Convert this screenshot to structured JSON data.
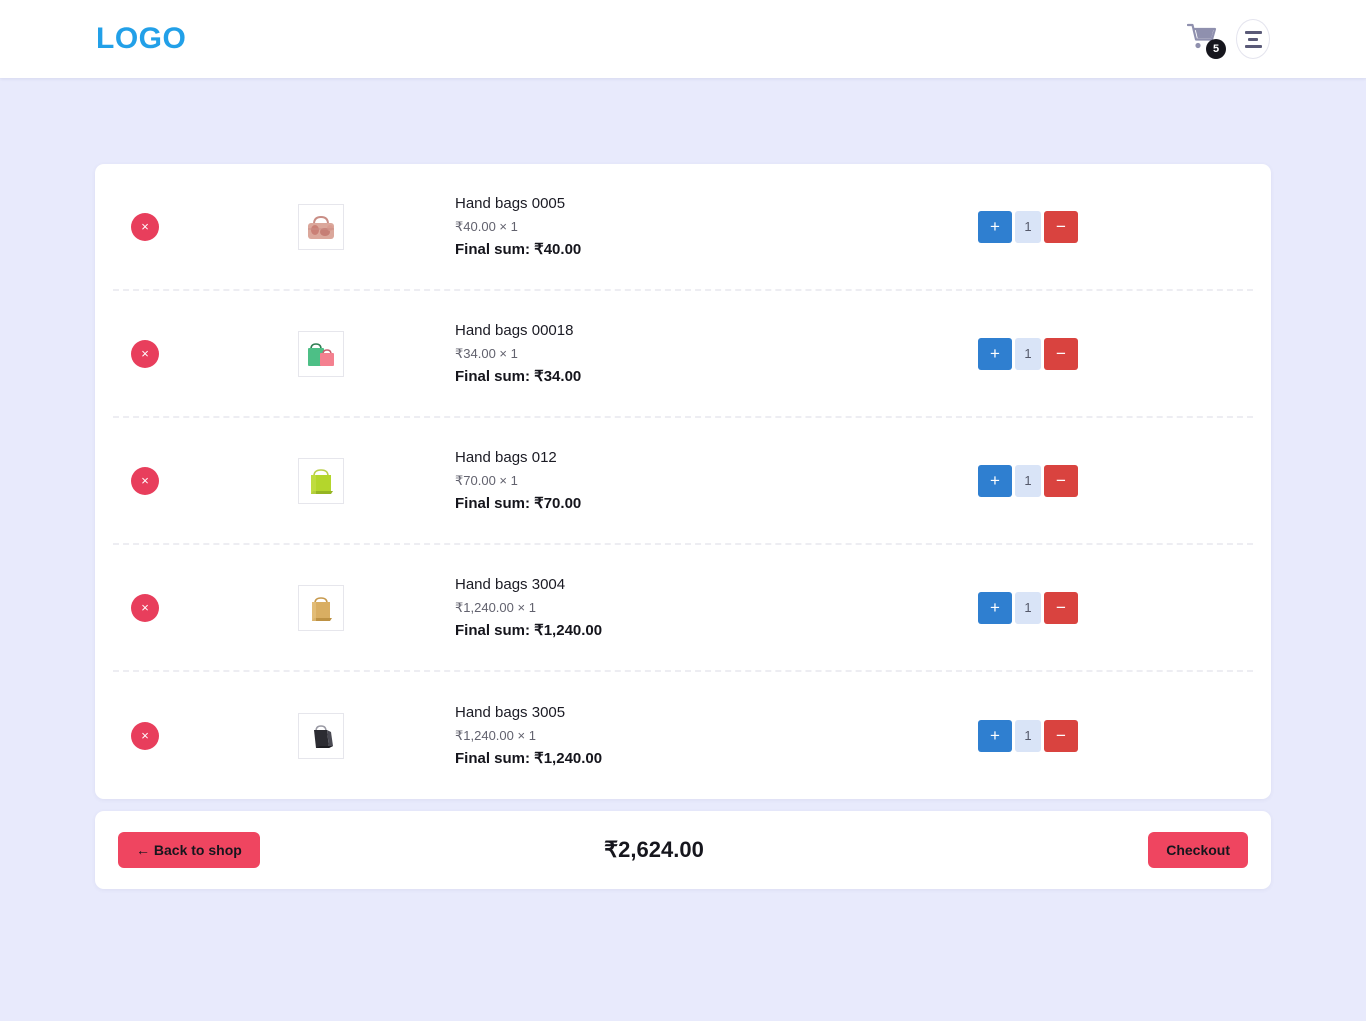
{
  "header": {
    "brand": "LOGO",
    "cart_icon": "shopping-cart-icon",
    "cart_count": "5",
    "menu_icon": "hamburger-menu-icon"
  },
  "cart": {
    "remove_label": "×",
    "increase_label": "+",
    "decrease_label": "−",
    "items": [
      {
        "name": "Hand bags 0005",
        "unit_line": "₹40.00 × 1",
        "final_sum": "Final sum: ₹40.00",
        "quantity": "1",
        "thumb": "handbag-floral-pink"
      },
      {
        "name": "Hand bags 00018",
        "unit_line": "₹34.00 × 1",
        "final_sum": "Final sum: ₹34.00",
        "quantity": "1",
        "thumb": "shopping-bags-green-pink"
      },
      {
        "name": "Hand bags 012",
        "unit_line": "₹70.00 × 1",
        "final_sum": "Final sum: ₹70.00",
        "quantity": "1",
        "thumb": "shopping-bag-lime"
      },
      {
        "name": "Hand bags 3004",
        "unit_line": "₹1,240.00 × 1",
        "final_sum": "Final sum: ₹1,240.00",
        "quantity": "1",
        "thumb": "shopping-bag-tan"
      },
      {
        "name": "Hand bags 3005",
        "unit_line": "₹1,240.00 × 1",
        "final_sum": "Final sum: ₹1,240.00",
        "quantity": "1",
        "thumb": "shopping-bag-black"
      }
    ]
  },
  "footer": {
    "back_label": "← Back to shop",
    "total": "₹2,624.00",
    "checkout_label": "Checkout"
  },
  "colors": {
    "page_background": "#e8eafc",
    "brand": "#22a0e8",
    "accent_red": "#ef4560",
    "remove_red": "#e83e5c",
    "plus_blue": "#2f7fd0",
    "minus_red": "#d9433f",
    "qty_field": "#d9e4f7"
  }
}
